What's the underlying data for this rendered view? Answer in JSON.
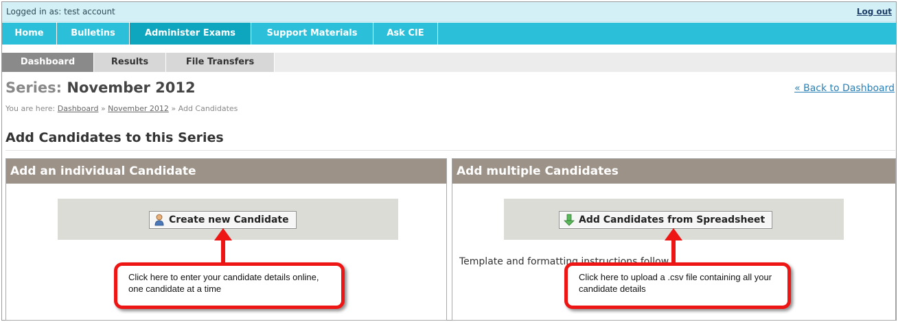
{
  "login": {
    "text": "Logged in as: test account",
    "logout_label": "Log out"
  },
  "main_nav": {
    "tabs": [
      {
        "label": "Home"
      },
      {
        "label": "Bulletins"
      },
      {
        "label": "Administer Exams",
        "active": true
      },
      {
        "label": "Support Materials"
      },
      {
        "label": "Ask CIE"
      }
    ]
  },
  "sub_nav": {
    "tabs": [
      {
        "label": "Dashboard",
        "active": true
      },
      {
        "label": "Results"
      },
      {
        "label": "File Transfers"
      }
    ]
  },
  "series": {
    "prefix": "Series:",
    "name": "November 2012",
    "back_label": "« Back to Dashboard"
  },
  "breadcrumb": {
    "prefix": "You are here:",
    "items": [
      "Dashboard",
      "November 2012",
      "Add Candidates"
    ],
    "separator": "»"
  },
  "page_heading": "Add Candidates to this Series",
  "left_panel": {
    "title": "Add an individual Candidate",
    "button_label": "Create new Candidate",
    "callout": "Click here to enter your candidate details online, one candidate at a time"
  },
  "right_panel": {
    "title": "Add multiple Candidates",
    "button_label": "Add Candidates from Spreadsheet",
    "template_text": "Template and formatting instructions follow",
    "callout": "Click here to upload a .csv file containing all your candidate details"
  },
  "colors": {
    "nav_bg": "#2cbfd9",
    "nav_active": "#0ea5bf",
    "panel_header": "#9c9287",
    "callout_border": "#ee1515",
    "link": "#2a7fb5"
  },
  "icons": {
    "create_candidate": "user-icon",
    "spreadsheet": "download-arrow-icon"
  }
}
